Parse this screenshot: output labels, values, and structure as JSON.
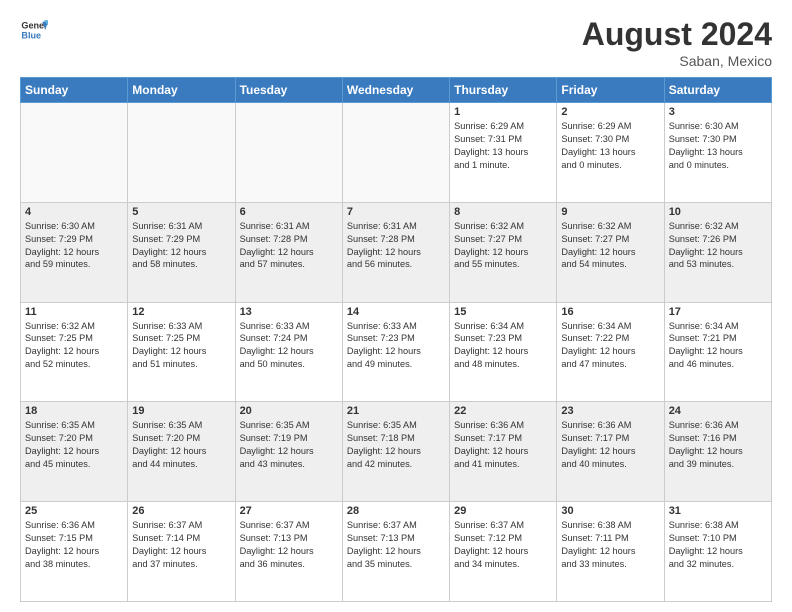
{
  "logo": {
    "text_general": "General",
    "text_blue": "Blue"
  },
  "header": {
    "month_year": "August 2024",
    "location": "Saban, Mexico"
  },
  "days_of_week": [
    "Sunday",
    "Monday",
    "Tuesday",
    "Wednesday",
    "Thursday",
    "Friday",
    "Saturday"
  ],
  "weeks": [
    {
      "shaded": false,
      "days": [
        {
          "date": "",
          "info": ""
        },
        {
          "date": "",
          "info": ""
        },
        {
          "date": "",
          "info": ""
        },
        {
          "date": "",
          "info": ""
        },
        {
          "date": "1",
          "info": "Sunrise: 6:29 AM\nSunset: 7:31 PM\nDaylight: 13 hours\nand 1 minute."
        },
        {
          "date": "2",
          "info": "Sunrise: 6:29 AM\nSunset: 7:30 PM\nDaylight: 13 hours\nand 0 minutes."
        },
        {
          "date": "3",
          "info": "Sunrise: 6:30 AM\nSunset: 7:30 PM\nDaylight: 13 hours\nand 0 minutes."
        }
      ]
    },
    {
      "shaded": true,
      "days": [
        {
          "date": "4",
          "info": "Sunrise: 6:30 AM\nSunset: 7:29 PM\nDaylight: 12 hours\nand 59 minutes."
        },
        {
          "date": "5",
          "info": "Sunrise: 6:31 AM\nSunset: 7:29 PM\nDaylight: 12 hours\nand 58 minutes."
        },
        {
          "date": "6",
          "info": "Sunrise: 6:31 AM\nSunset: 7:28 PM\nDaylight: 12 hours\nand 57 minutes."
        },
        {
          "date": "7",
          "info": "Sunrise: 6:31 AM\nSunset: 7:28 PM\nDaylight: 12 hours\nand 56 minutes."
        },
        {
          "date": "8",
          "info": "Sunrise: 6:32 AM\nSunset: 7:27 PM\nDaylight: 12 hours\nand 55 minutes."
        },
        {
          "date": "9",
          "info": "Sunrise: 6:32 AM\nSunset: 7:27 PM\nDaylight: 12 hours\nand 54 minutes."
        },
        {
          "date": "10",
          "info": "Sunrise: 6:32 AM\nSunset: 7:26 PM\nDaylight: 12 hours\nand 53 minutes."
        }
      ]
    },
    {
      "shaded": false,
      "days": [
        {
          "date": "11",
          "info": "Sunrise: 6:32 AM\nSunset: 7:25 PM\nDaylight: 12 hours\nand 52 minutes."
        },
        {
          "date": "12",
          "info": "Sunrise: 6:33 AM\nSunset: 7:25 PM\nDaylight: 12 hours\nand 51 minutes."
        },
        {
          "date": "13",
          "info": "Sunrise: 6:33 AM\nSunset: 7:24 PM\nDaylight: 12 hours\nand 50 minutes."
        },
        {
          "date": "14",
          "info": "Sunrise: 6:33 AM\nSunset: 7:23 PM\nDaylight: 12 hours\nand 49 minutes."
        },
        {
          "date": "15",
          "info": "Sunrise: 6:34 AM\nSunset: 7:23 PM\nDaylight: 12 hours\nand 48 minutes."
        },
        {
          "date": "16",
          "info": "Sunrise: 6:34 AM\nSunset: 7:22 PM\nDaylight: 12 hours\nand 47 minutes."
        },
        {
          "date": "17",
          "info": "Sunrise: 6:34 AM\nSunset: 7:21 PM\nDaylight: 12 hours\nand 46 minutes."
        }
      ]
    },
    {
      "shaded": true,
      "days": [
        {
          "date": "18",
          "info": "Sunrise: 6:35 AM\nSunset: 7:20 PM\nDaylight: 12 hours\nand 45 minutes."
        },
        {
          "date": "19",
          "info": "Sunrise: 6:35 AM\nSunset: 7:20 PM\nDaylight: 12 hours\nand 44 minutes."
        },
        {
          "date": "20",
          "info": "Sunrise: 6:35 AM\nSunset: 7:19 PM\nDaylight: 12 hours\nand 43 minutes."
        },
        {
          "date": "21",
          "info": "Sunrise: 6:35 AM\nSunset: 7:18 PM\nDaylight: 12 hours\nand 42 minutes."
        },
        {
          "date": "22",
          "info": "Sunrise: 6:36 AM\nSunset: 7:17 PM\nDaylight: 12 hours\nand 41 minutes."
        },
        {
          "date": "23",
          "info": "Sunrise: 6:36 AM\nSunset: 7:17 PM\nDaylight: 12 hours\nand 40 minutes."
        },
        {
          "date": "24",
          "info": "Sunrise: 6:36 AM\nSunset: 7:16 PM\nDaylight: 12 hours\nand 39 minutes."
        }
      ]
    },
    {
      "shaded": false,
      "days": [
        {
          "date": "25",
          "info": "Sunrise: 6:36 AM\nSunset: 7:15 PM\nDaylight: 12 hours\nand 38 minutes."
        },
        {
          "date": "26",
          "info": "Sunrise: 6:37 AM\nSunset: 7:14 PM\nDaylight: 12 hours\nand 37 minutes."
        },
        {
          "date": "27",
          "info": "Sunrise: 6:37 AM\nSunset: 7:13 PM\nDaylight: 12 hours\nand 36 minutes."
        },
        {
          "date": "28",
          "info": "Sunrise: 6:37 AM\nSunset: 7:13 PM\nDaylight: 12 hours\nand 35 minutes."
        },
        {
          "date": "29",
          "info": "Sunrise: 6:37 AM\nSunset: 7:12 PM\nDaylight: 12 hours\nand 34 minutes."
        },
        {
          "date": "30",
          "info": "Sunrise: 6:38 AM\nSunset: 7:11 PM\nDaylight: 12 hours\nand 33 minutes."
        },
        {
          "date": "31",
          "info": "Sunrise: 6:38 AM\nSunset: 7:10 PM\nDaylight: 12 hours\nand 32 minutes."
        }
      ]
    }
  ]
}
